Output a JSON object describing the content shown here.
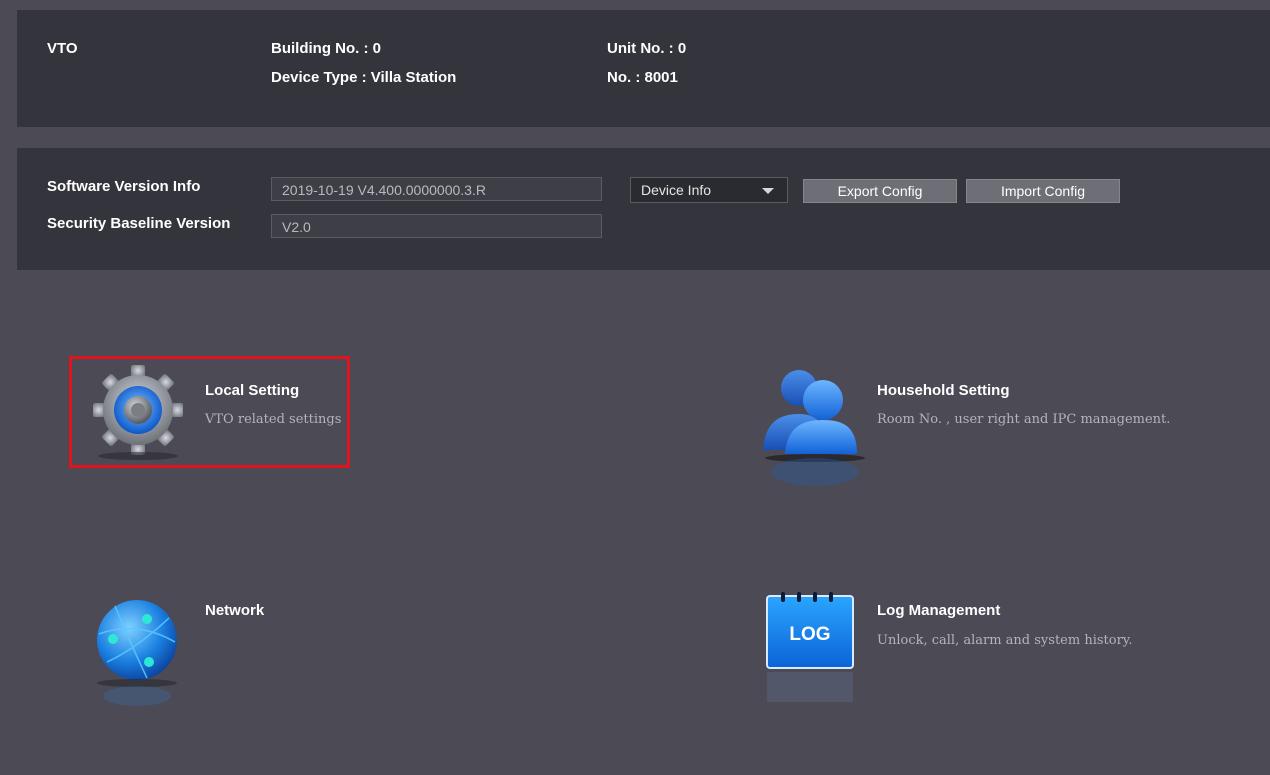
{
  "info": {
    "device_name": "VTO",
    "building": "Building No. : 0",
    "device_type": "Device Type : Villa Station",
    "unit": "Unit No. : 0",
    "number": "No. : 8001"
  },
  "version": {
    "software_label": "Software Version Info",
    "software_value": "2019-10-19 V4.400.0000000.3.R",
    "baseline_label": "Security Baseline Version",
    "baseline_value": "V2.0",
    "dropdown_selected": "Device Info",
    "export_label": "Export Config",
    "import_label": "Import Config"
  },
  "tiles": [
    {
      "title": "Local Setting",
      "desc": "VTO related settings",
      "icon": "gear-icon",
      "selected": true
    },
    {
      "title": "Household Setting",
      "desc": "Room No. , user right and IPC management.",
      "icon": "users-icon"
    },
    {
      "title": "Network",
      "desc": "",
      "icon": "globe-icon"
    },
    {
      "title": "Log Management",
      "desc": "Unlock, call, alarm and system history.",
      "icon": "log-icon",
      "icon_text": "LOG"
    }
  ],
  "colors": {
    "background": "#4b4a55",
    "panel": "#34343c",
    "highlight": "#e0141c",
    "accent_blue": "#1e78e6"
  }
}
